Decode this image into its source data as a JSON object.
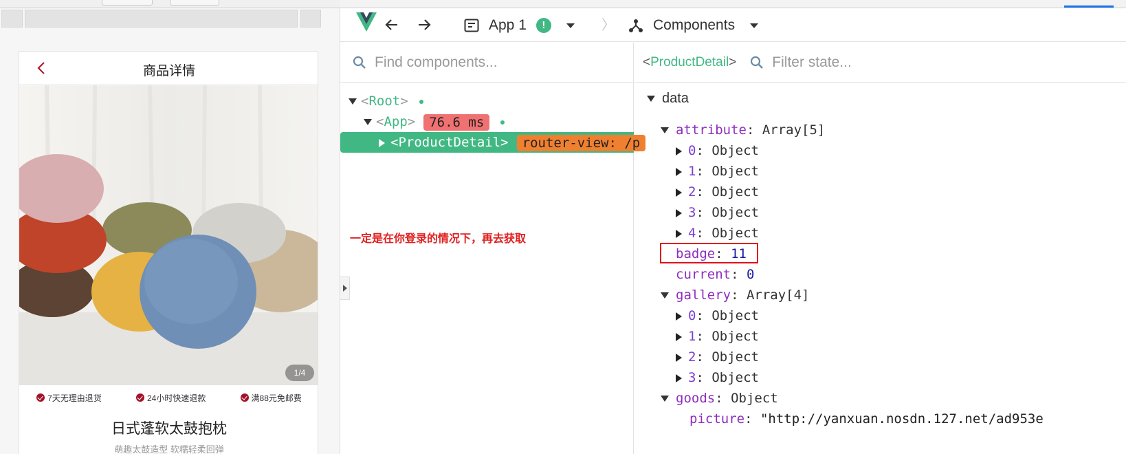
{
  "mobile": {
    "header_title": "商品详情",
    "image_counter": "1/4",
    "promises": [
      "7天无理由退货",
      "24小时快速退款",
      "满88元免邮费"
    ],
    "product_name": "日式蓬软太鼓抱枕",
    "product_desc": "萌趣太鼓造型 软糯轻柔回弹"
  },
  "devtools": {
    "app_selector": "App 1",
    "app_badge": "!",
    "components_label": "Components",
    "find_placeholder": "Find components...",
    "filter_placeholder": "Filter state...",
    "breadcrumb": "ProductDetail",
    "tree": {
      "root": "Root",
      "app": "App",
      "app_time": "76.6 ms",
      "selected": "ProductDetail",
      "router_badge": "router-view: /p"
    },
    "note": "一定是在你登录的情况下，再去获取",
    "state": {
      "section": "data",
      "rows": [
        {
          "key": "attribute",
          "value": "Array[5]"
        },
        {
          "key": "0",
          "value": "Object"
        },
        {
          "key": "1",
          "value": "Object"
        },
        {
          "key": "2",
          "value": "Object"
        },
        {
          "key": "3",
          "value": "Object"
        },
        {
          "key": "4",
          "value": "Object"
        },
        {
          "key": "badge",
          "value": "11"
        },
        {
          "key": "current",
          "value": "0"
        },
        {
          "key": "gallery",
          "value": "Array[4]"
        },
        {
          "key": "0",
          "value": "Object"
        },
        {
          "key": "1",
          "value": "Object"
        },
        {
          "key": "2",
          "value": "Object"
        },
        {
          "key": "3",
          "value": "Object"
        },
        {
          "key": "goods",
          "value": "Object"
        },
        {
          "key": "picture",
          "value": "\"http://yanxuan.nosdn.127.net/ad953e"
        }
      ]
    }
  },
  "colors": {
    "vue_green": "#41b883",
    "badge_red": "#f07171",
    "router_orange": "#f08030",
    "highlight_red": "#e0101a",
    "brand_red": "#a3122a"
  }
}
